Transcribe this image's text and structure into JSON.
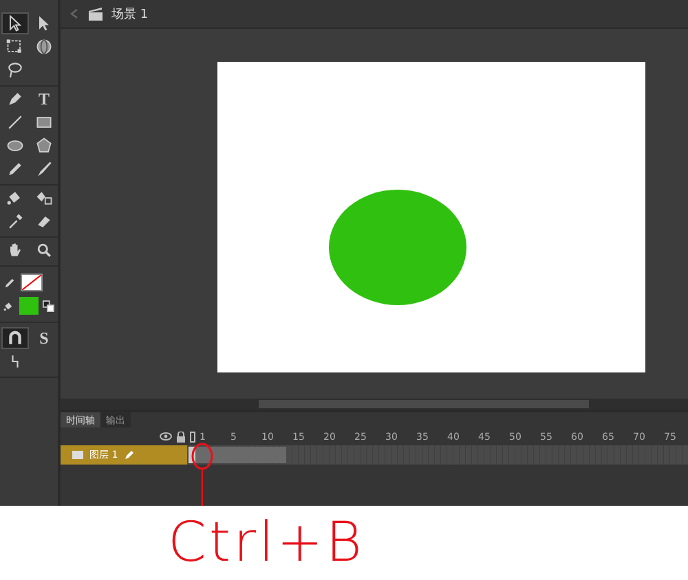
{
  "scene_bar": {
    "label": "场景 1"
  },
  "tool_groups": [
    {
      "tools": [
        {
          "kind": "arrow",
          "selected": true
        },
        {
          "kind": "subselect",
          "selected": false
        },
        {
          "kind": "transform",
          "selected": false
        },
        {
          "kind": "globe",
          "selected": false
        },
        {
          "kind": "lasso",
          "selected": false
        }
      ]
    },
    {
      "tools": [
        {
          "kind": "pen",
          "selected": false
        },
        {
          "kind": "text",
          "glyph": "T",
          "selected": false
        },
        {
          "kind": "line",
          "selected": false
        },
        {
          "kind": "rect",
          "selected": false
        },
        {
          "kind": "oval",
          "selected": false
        },
        {
          "kind": "polystar",
          "selected": false
        },
        {
          "kind": "pencil",
          "selected": false
        },
        {
          "kind": "brush",
          "selected": false
        }
      ]
    },
    {
      "tools": [
        {
          "kind": "bucket",
          "selected": false
        },
        {
          "kind": "inkbottle",
          "selected": false
        },
        {
          "kind": "eyedropper",
          "selected": false
        },
        {
          "kind": "eraser",
          "selected": false
        }
      ]
    },
    {
      "tools": [
        {
          "kind": "hand",
          "selected": false
        },
        {
          "kind": "zoom",
          "selected": false
        }
      ]
    }
  ],
  "stroke": {
    "none": true
  },
  "fill": {
    "color": "#30c010"
  },
  "options": [
    {
      "kind": "magnet",
      "selected": true
    },
    {
      "kind": "glyph",
      "glyph": "S",
      "selected": false
    },
    {
      "kind": "straighten",
      "selected": false
    }
  ],
  "timeline": {
    "tabs": [
      {
        "label": "时间轴",
        "selected": true
      },
      {
        "label": "输出",
        "selected": false
      }
    ],
    "ruler": [
      "1",
      "5",
      "10",
      "15",
      "20",
      "25",
      "30",
      "35",
      "40",
      "45",
      "50",
      "55",
      "60",
      "65",
      "70",
      "75"
    ],
    "layers": [
      {
        "name": "图层 1",
        "selected": true
      }
    ]
  },
  "annotation": {
    "text": "Ctrl+B"
  }
}
